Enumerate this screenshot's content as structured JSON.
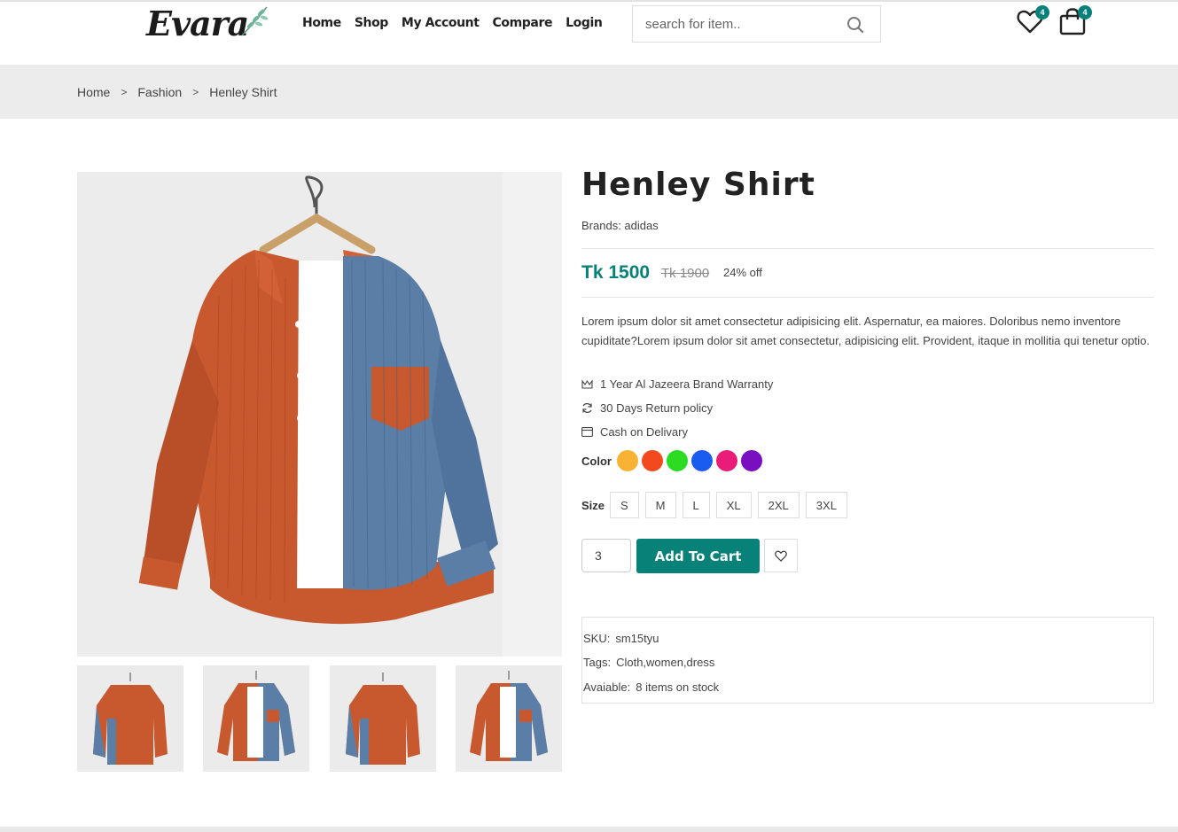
{
  "header": {
    "logo_text": "Evara",
    "nav": [
      "Home",
      "Shop",
      "My Account",
      "Compare",
      "Login"
    ],
    "search_placeholder": "search for item..",
    "wishlist_count": "4",
    "cart_count": "4"
  },
  "breadcrumb": [
    "Home",
    "Fashion",
    "Henley Shirt"
  ],
  "breadcrumb_sep": ">",
  "product": {
    "title": "Henley Shirt",
    "brand": "Brands: adidas",
    "price": "Tk 1500",
    "old_price": "Tk 1900",
    "discount": "24% off",
    "description": "Lorem ipsum dolor sit amet consectetur adipisicing elit. Aspernatur, ea maiores. Doloribus nemo inventore cupiditate?Lorem ipsum dolor sit amet consectetur, adipisicing elit. Provident, itaque in mollitia qui tenetur optio.",
    "features": [
      "1 Year Al Jazeera Brand Warranty",
      "30 Days Return policy",
      "Cash on Delivary"
    ],
    "color_label": "Color",
    "colors": [
      "#f9b233",
      "#f24a1d",
      "#2bdc22",
      "#1a5cf0",
      "#e91c7a",
      "#7a0fbf"
    ],
    "size_label": "Size",
    "sizes": [
      "S",
      "M",
      "L",
      "XL",
      "2XL",
      "3XL"
    ],
    "quantity": "3",
    "add_to_cart": "Add To Cart",
    "sku_label": "SKU:",
    "sku": "sm15tyu",
    "tags_label": "Tags:",
    "tags": "Cloth,women,dress",
    "available_label": "Avaiable:",
    "available": "8 items on stock"
  },
  "colors": {
    "accent": "#088178",
    "breadcrumb_bg": "#ececec"
  }
}
